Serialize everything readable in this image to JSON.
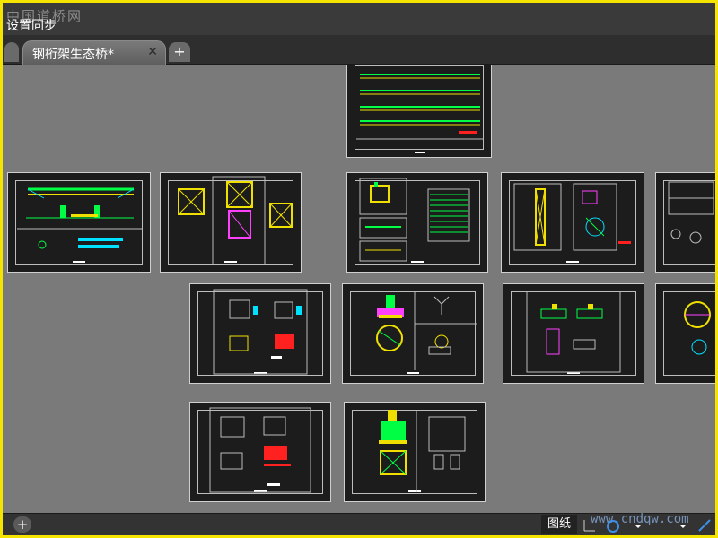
{
  "header": {
    "watermark": "中国道桥网",
    "menu_label": "设置同步"
  },
  "tabs": {
    "active": {
      "label": "钢桁架生态桥*"
    },
    "close_glyph": "✕",
    "add_glyph": "+"
  },
  "status": {
    "add_glyph": "+",
    "paper_label": "图纸",
    "watermark": "www.cndqw.com",
    "icons": [
      "ucs-axis-icon",
      "orbit-icon",
      "dropdown-icon",
      "dropdown-icon",
      "scale-icon"
    ]
  },
  "colors": {
    "canvas": "#7a7a7a",
    "sheet": "#1c1c1c",
    "frame": "#f5e400",
    "drawing_yellow": "#f0e000",
    "drawing_green": "#00ff44",
    "drawing_cyan": "#00e0ff",
    "drawing_magenta": "#ff40ff",
    "drawing_red": "#ff2020"
  }
}
